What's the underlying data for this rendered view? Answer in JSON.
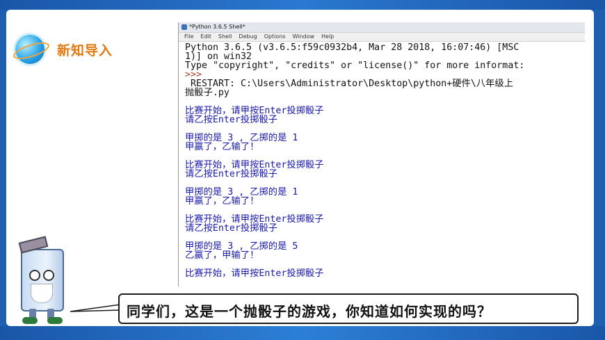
{
  "slide": {
    "section_title": "新知导入",
    "bubble_text": "同学们，这是一个抛骰子的游戏，你知道如何实现的吗？"
  },
  "idle": {
    "window_title": "*Python 3.6.5 Shell*",
    "menu": [
      "File",
      "Edit",
      "Shell",
      "Debug",
      "Options",
      "Window",
      "Help"
    ],
    "lines": [
      {
        "type": "black",
        "text": "Python 3.6.5 (v3.6.5:f59c0932b4, Mar 28 2018, 16:07:46) [MSC"
      },
      {
        "type": "black",
        "text": "1)] on win32"
      },
      {
        "type": "black",
        "text": "Type \"copyright\", \"credits\" or \"license()\" for more informat:"
      },
      {
        "type": "prompt",
        "text": ">>>"
      },
      {
        "type": "black",
        "text": " RESTART: C:\\Users\\Administrator\\Desktop\\python+硬件\\八年级上"
      },
      {
        "type": "black",
        "text": "抛骰子.py"
      },
      {
        "type": "blank",
        "text": ""
      },
      {
        "type": "out",
        "text": "比赛开始，请甲按Enter投掷骰子"
      },
      {
        "type": "out",
        "text": "请乙按Enter投掷骰子"
      },
      {
        "type": "blank",
        "text": ""
      },
      {
        "type": "out",
        "text": "甲掷的是 3 , 乙掷的是 1"
      },
      {
        "type": "out",
        "text": "甲赢了，乙输了！"
      },
      {
        "type": "blank",
        "text": ""
      },
      {
        "type": "out",
        "text": "比赛开始，请甲按Enter投掷骰子"
      },
      {
        "type": "out",
        "text": "请乙按Enter投掷骰子"
      },
      {
        "type": "blank",
        "text": ""
      },
      {
        "type": "out",
        "text": "甲掷的是 3 , 乙掷的是 1"
      },
      {
        "type": "out",
        "text": "甲赢了，乙输了！"
      },
      {
        "type": "blank",
        "text": ""
      },
      {
        "type": "out",
        "text": "比赛开始，请甲按Enter投掷骰子"
      },
      {
        "type": "out",
        "text": "请乙按Enter投掷骰子"
      },
      {
        "type": "blank",
        "text": ""
      },
      {
        "type": "out",
        "text": "甲掷的是 3 , 乙掷的是 5"
      },
      {
        "type": "out",
        "text": "乙赢了，甲输了！"
      },
      {
        "type": "blank",
        "text": ""
      },
      {
        "type": "out",
        "text": "比赛开始，请甲按Enter投掷骰子"
      }
    ]
  },
  "colors": {
    "frame": "#1f5fb0",
    "title_orange": "#e07a12",
    "output_blue": "#1a1aa8",
    "prompt_red": "#9a3d28"
  }
}
